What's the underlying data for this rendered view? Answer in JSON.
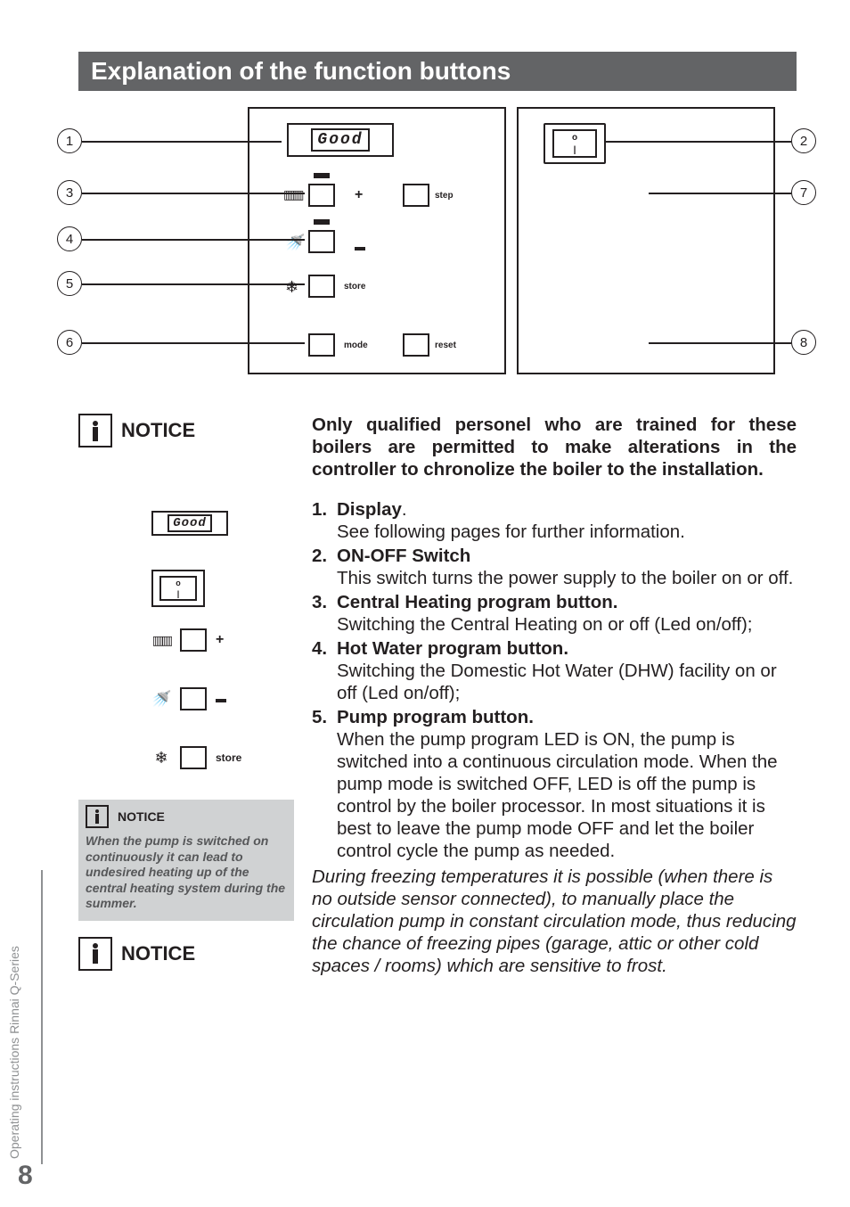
{
  "section_title": "Explanation of the function buttons",
  "diagram": {
    "lcd_text": "Good",
    "switch": {
      "top": "o",
      "bottom": "|"
    },
    "btn_labels": {
      "step": "step",
      "store": "store",
      "mode": "mode",
      "reset": "reset"
    },
    "callouts": {
      "c1": "1",
      "c2": "2",
      "c3": "3",
      "c4": "4",
      "c5": "5",
      "c6": "6",
      "c7": "7",
      "c8": "8"
    }
  },
  "notice_word": "NOTICE",
  "lead_paragraph": "Only qualified personel who are trained for these boilers are permitted to make alterations in the controller to chronolize the boiler to the installation.",
  "items": [
    {
      "n": "1.",
      "title": "Display",
      "title_suffix": ".",
      "desc": "See following pages for further information."
    },
    {
      "n": "2.",
      "title": "ON-OFF Switch",
      "desc": "This switch turns the power supply to the boiler on or off."
    },
    {
      "n": "3.",
      "title": "Central Heating program button.",
      "desc": "Switching the Central Heating on or off  (Led on/off);"
    },
    {
      "n": "4.",
      "title": "Hot Water program button.",
      "desc": "Switching the Domestic Hot Water (DHW) facility on or off  (Led on/off);"
    },
    {
      "n": "5.",
      "title": "Pump program button.",
      "desc": "When the pump program LED is ON, the pump is switched into a continuous circulation mode. When the pump mode is switched OFF, LED is off the pump is control by the boiler processor. In most situations it is best to leave the pump mode OFF and let the boiler control cycle the pump as needed."
    }
  ],
  "freeze_note": "During freezing temperatures it is possible (when there is no outside sensor connected), to manually place the circulation pump in constant circulation mode, thus reducing the chance of freezing pipes (garage, attic or other cold spaces / rooms) which are sensitive to frost.",
  "small_notice_text": "When the pump is switched on continuously it can lead to undesired heating up of the central heating system during the summer.",
  "mini": {
    "lcd_text": "Good",
    "switch": {
      "top": "o",
      "bottom": "|"
    },
    "store": "store"
  },
  "footer": {
    "side_text": "Operating instructions Rinnai Q-Series",
    "page_no": "8"
  }
}
